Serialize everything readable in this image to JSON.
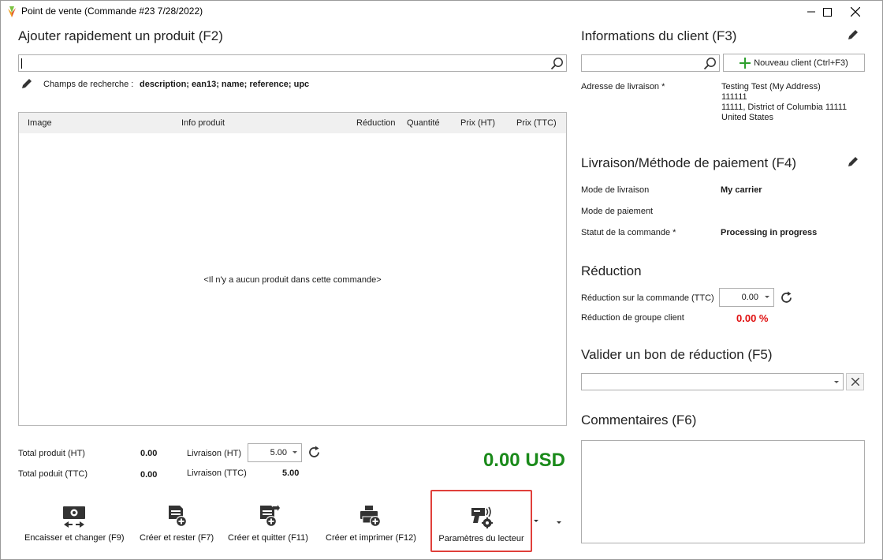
{
  "window": {
    "title": "Point de vente (Commande #23 7/28/2022)"
  },
  "quick_add": {
    "heading": "Ajouter rapidement un produit (F2)",
    "search_value": "",
    "search_fields_label": "Champs de recherche :",
    "search_fields_value": "description; ean13; name; reference; upc"
  },
  "grid": {
    "columns": [
      "Image",
      "Info produit",
      "Réduction",
      "Quantité",
      "Prix (HT)",
      "Prix (TTC)"
    ],
    "empty_message": "<Il n'y a aucun produit dans cette commande>"
  },
  "totals": {
    "product_ht_label": "Total produit (HT)",
    "product_ht_value": "0.00",
    "product_ttc_label": "Total poduit (TTC)",
    "product_ttc_value": "0.00",
    "shipping_ht_label": "Livraison (HT)",
    "shipping_ht_value": "5.00",
    "shipping_ttc_label": "Livraison (TTC)",
    "shipping_ttc_value": "5.00",
    "grand_total": "0.00 USD",
    "grand_total_color": "#1a8a1a"
  },
  "toolbar": {
    "buttons": [
      {
        "label": "Encaisser et changer (F9)",
        "icon": "cash-exchange-icon"
      },
      {
        "label": "Créer et rester (F7)",
        "icon": "document-add-icon"
      },
      {
        "label": "Créer et quitter (F11)",
        "icon": "document-exit-icon"
      },
      {
        "label": "Créer et imprimer (F12)",
        "icon": "printer-add-icon"
      },
      {
        "label": "Paramètres du lecteur",
        "icon": "scanner-settings-icon"
      }
    ],
    "highlight_color": "#e0403b"
  },
  "client": {
    "heading": "Informations du client (F3)",
    "search_value": "",
    "new_client_label": "Nouveau client (Ctrl+F3)",
    "delivery_address_label": "Adresse de livraison *",
    "address_lines": [
      "Testing Test (My Address)",
      "111111",
      "11111, District of Columbia 11111",
      "United States"
    ]
  },
  "shipping_payment": {
    "heading": "Livraison/Méthode de paiement (F4)",
    "carrier_label": "Mode de livraison",
    "carrier_value": "My carrier",
    "payment_label": "Mode de paiement",
    "payment_value": "",
    "status_label": "Statut de la commande *",
    "status_value": "Processing in progress"
  },
  "discount": {
    "heading": "Réduction",
    "order_discount_label": "Réduction sur la commande (TTC)",
    "order_discount_value": "0.00",
    "group_discount_label": "Réduction de groupe client",
    "group_discount_value": "0.00 %",
    "group_discount_color": "#e01010"
  },
  "voucher": {
    "heading": "Valider un bon de réduction (F5)",
    "value": ""
  },
  "comments": {
    "heading": "Commentaires (F6)",
    "value": ""
  }
}
